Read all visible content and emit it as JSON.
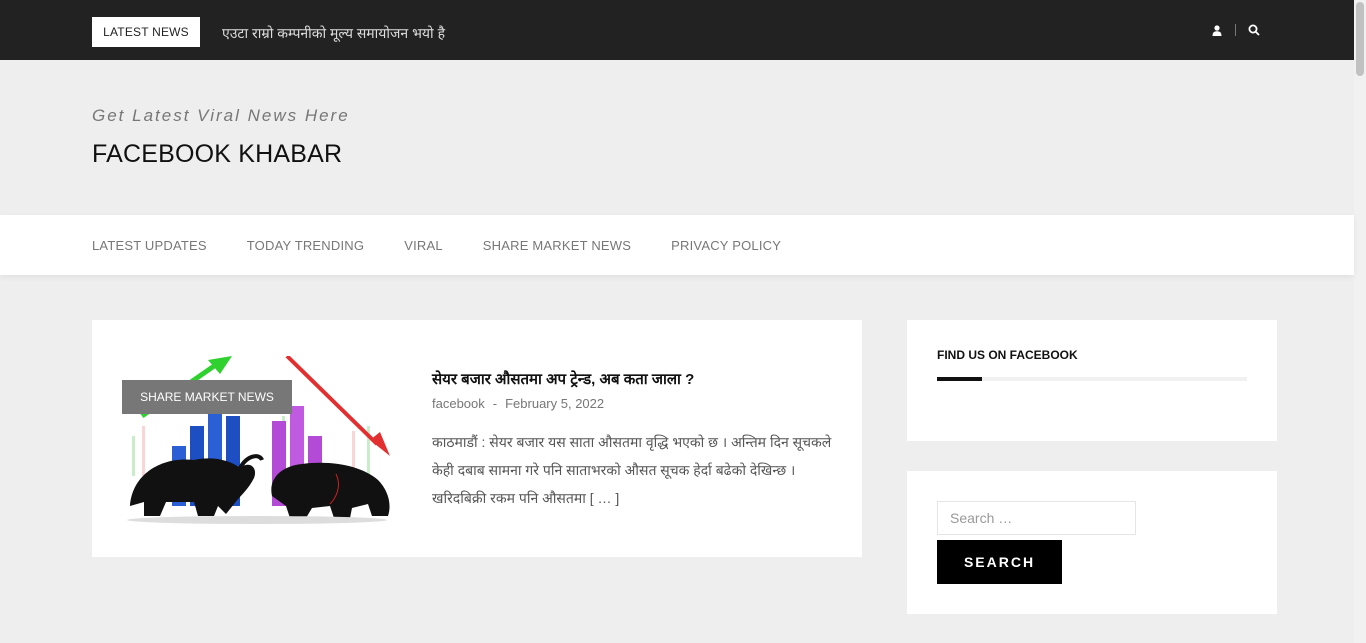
{
  "topbar": {
    "latest_label": "LATEST NEWS",
    "ticker_text": "एउटा राम्रो कम्पनीको मूल्य समायोजन भयो है",
    "user_icon": "user-icon",
    "search_icon": "search-icon"
  },
  "branding": {
    "tagline": "Get Latest Viral News Here",
    "title": "FACEBOOK KHABAR"
  },
  "nav": {
    "items": [
      {
        "label": "LATEST UPDATES"
      },
      {
        "label": "TODAY TRENDING"
      },
      {
        "label": "VIRAL"
      },
      {
        "label": "SHARE MARKET NEWS"
      },
      {
        "label": "PRIVACY POLICY"
      }
    ]
  },
  "post": {
    "category": "SHARE MARKET NEWS",
    "title": "सेयर बजार औसतमा अप ट्रेन्ड, अब कता जाला ?",
    "author": "facebook",
    "separator": "-",
    "date": "February 5, 2022",
    "excerpt": "काठमाडौं : सेयर बजार यस साता औसतमा वृद्धि भएको छ । अन्तिम दिन सूचकले केही दबाब सामना गरे पनि साताभरको औसत सूचक हेर्दा बढेको देखिन्छ । खरिदबिक्री रकम पनि औसतमा [ … ]"
  },
  "sidebar": {
    "facebook_widget_title": "FIND US ON FACEBOOK",
    "search": {
      "placeholder": "Search …",
      "button_label": "SEARCH"
    }
  },
  "colors": {
    "topbar_bg": "#222222",
    "page_bg": "#eeeeee",
    "badge_bg": "#777777",
    "button_bg": "#000000"
  }
}
